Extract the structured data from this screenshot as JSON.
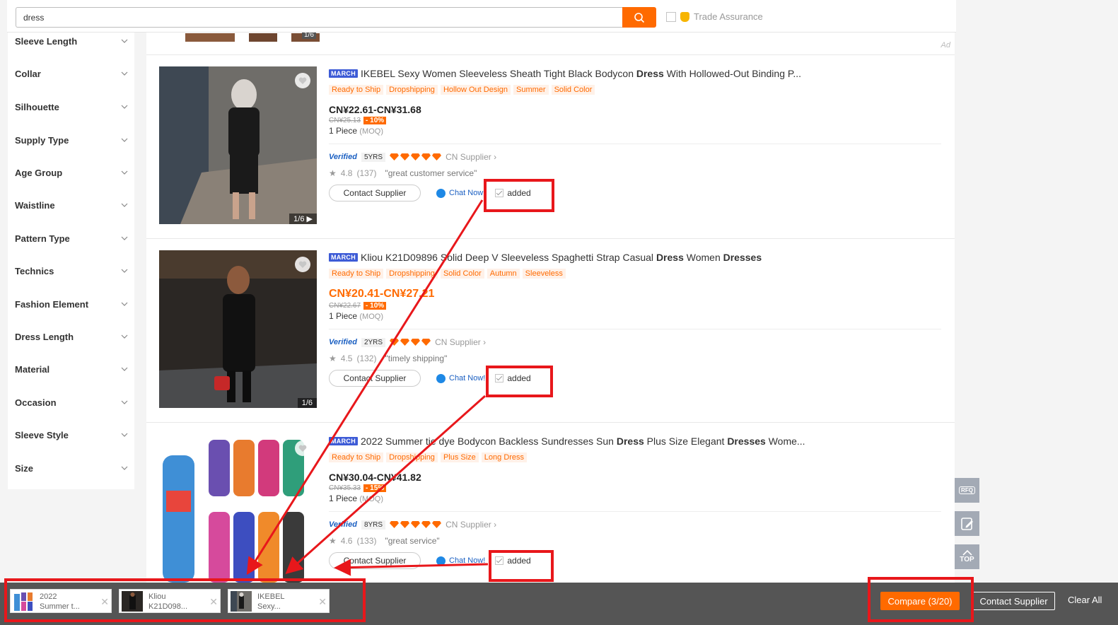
{
  "search": {
    "value": "dress",
    "trade_assurance": "Trade Assurance"
  },
  "filters": [
    "Sleeve Length",
    "Collar",
    "Silhouette",
    "Supply Type",
    "Age Group",
    "Waistline",
    "Pattern Type",
    "Technics",
    "Fashion Element",
    "Dress Length",
    "Material",
    "Occasion",
    "Sleeve Style",
    "Size"
  ],
  "ad_label": "Ad",
  "prev_counter": "1/6",
  "products": [
    {
      "badge": "MARCH",
      "title_pre": "IKEBEL Sexy Women Sleeveless Sheath Tight Black Bodycon ",
      "title_b1": "Dress",
      "title_mid": " With Hollowed-Out Binding P...",
      "title_b2": "",
      "title_post": "",
      "tags": [
        "Ready to Ship",
        "Dropshipping",
        "Hollow Out Design",
        "Summer",
        "Solid Color"
      ],
      "price": "CN¥22.61-CN¥31.68",
      "orig_price": "CN¥25.13",
      "discount": "- 10%",
      "moq": "1 Piece",
      "moq_label": "(MOQ)",
      "verified": "Verified",
      "years": "5YRS",
      "diamonds": 5,
      "supplier": "CN Supplier",
      "rating": "4.8",
      "reviews": "(137)",
      "quote": "\"great customer service\"",
      "contact": "Contact Supplier",
      "chat": "Chat Now!",
      "added": "added",
      "counter": "1/6"
    },
    {
      "badge": "MARCH",
      "title_pre": "Kliou K21D09896 Solid Deep V Sleeveless Spaghetti Strap Casual ",
      "title_b1": "Dress",
      "title_mid": " Women ",
      "title_b2": "Dresses",
      "title_post": "",
      "tags": [
        "Ready to Ship",
        "Dropshipping",
        "Solid Color",
        "Autumn",
        "Sleeveless"
      ],
      "price": "CN¥20.41-CN¥27.21",
      "orig_price": "CN¥22.67",
      "discount": "- 10%",
      "moq": "1 Piece",
      "moq_label": "(MOQ)",
      "verified": "Verified",
      "years": "2YRS",
      "diamonds": 4,
      "supplier": "CN Supplier",
      "rating": "4.5",
      "reviews": "(132)",
      "quote": "\"timely shipping\"",
      "contact": "Contact Supplier",
      "chat": "Chat Now!",
      "added": "added",
      "counter": "1/6"
    },
    {
      "badge": "MARCH",
      "title_pre": "2022 Summer tie dye Bodycon Backless Sundresses Sun ",
      "title_b1": "Dress",
      "title_mid": " Plus Size Elegant ",
      "title_b2": "Dresses",
      "title_post": " Wome...",
      "tags": [
        "Ready to Ship",
        "Dropshipping",
        "Plus Size",
        "Long Dress"
      ],
      "price": "CN¥30.04-CN¥41.82",
      "orig_price": "CN¥35.33",
      "discount": "- 15%",
      "moq": "1 Piece",
      "moq_label": "(MOQ)",
      "verified": "Verified",
      "years": "8YRS",
      "diamonds": 5,
      "supplier": "CN Supplier",
      "rating": "4.6",
      "reviews": "(133)",
      "quote": "\"great service\"",
      "contact": "Contact Supplier",
      "chat": "Chat Now!",
      "added": "added",
      "counter": ""
    }
  ],
  "side_tools": {
    "rfq": "RFQ",
    "top": "TOP"
  },
  "compare_items": [
    {
      "line1": "2022",
      "line2": "Summer t..."
    },
    {
      "line1": "Kliou",
      "line2": "K21D098..."
    },
    {
      "line1": "IKEBEL",
      "line2": "Sexy..."
    }
  ],
  "compare_bar": {
    "compare": "Compare (3/20)",
    "contact": "Contact Supplier",
    "clear": "Clear All"
  },
  "colors": {
    "accent": "#ff6a00",
    "annotation": "#e8171b",
    "march": "#3d5bd6",
    "verified": "#1a5fc2"
  }
}
